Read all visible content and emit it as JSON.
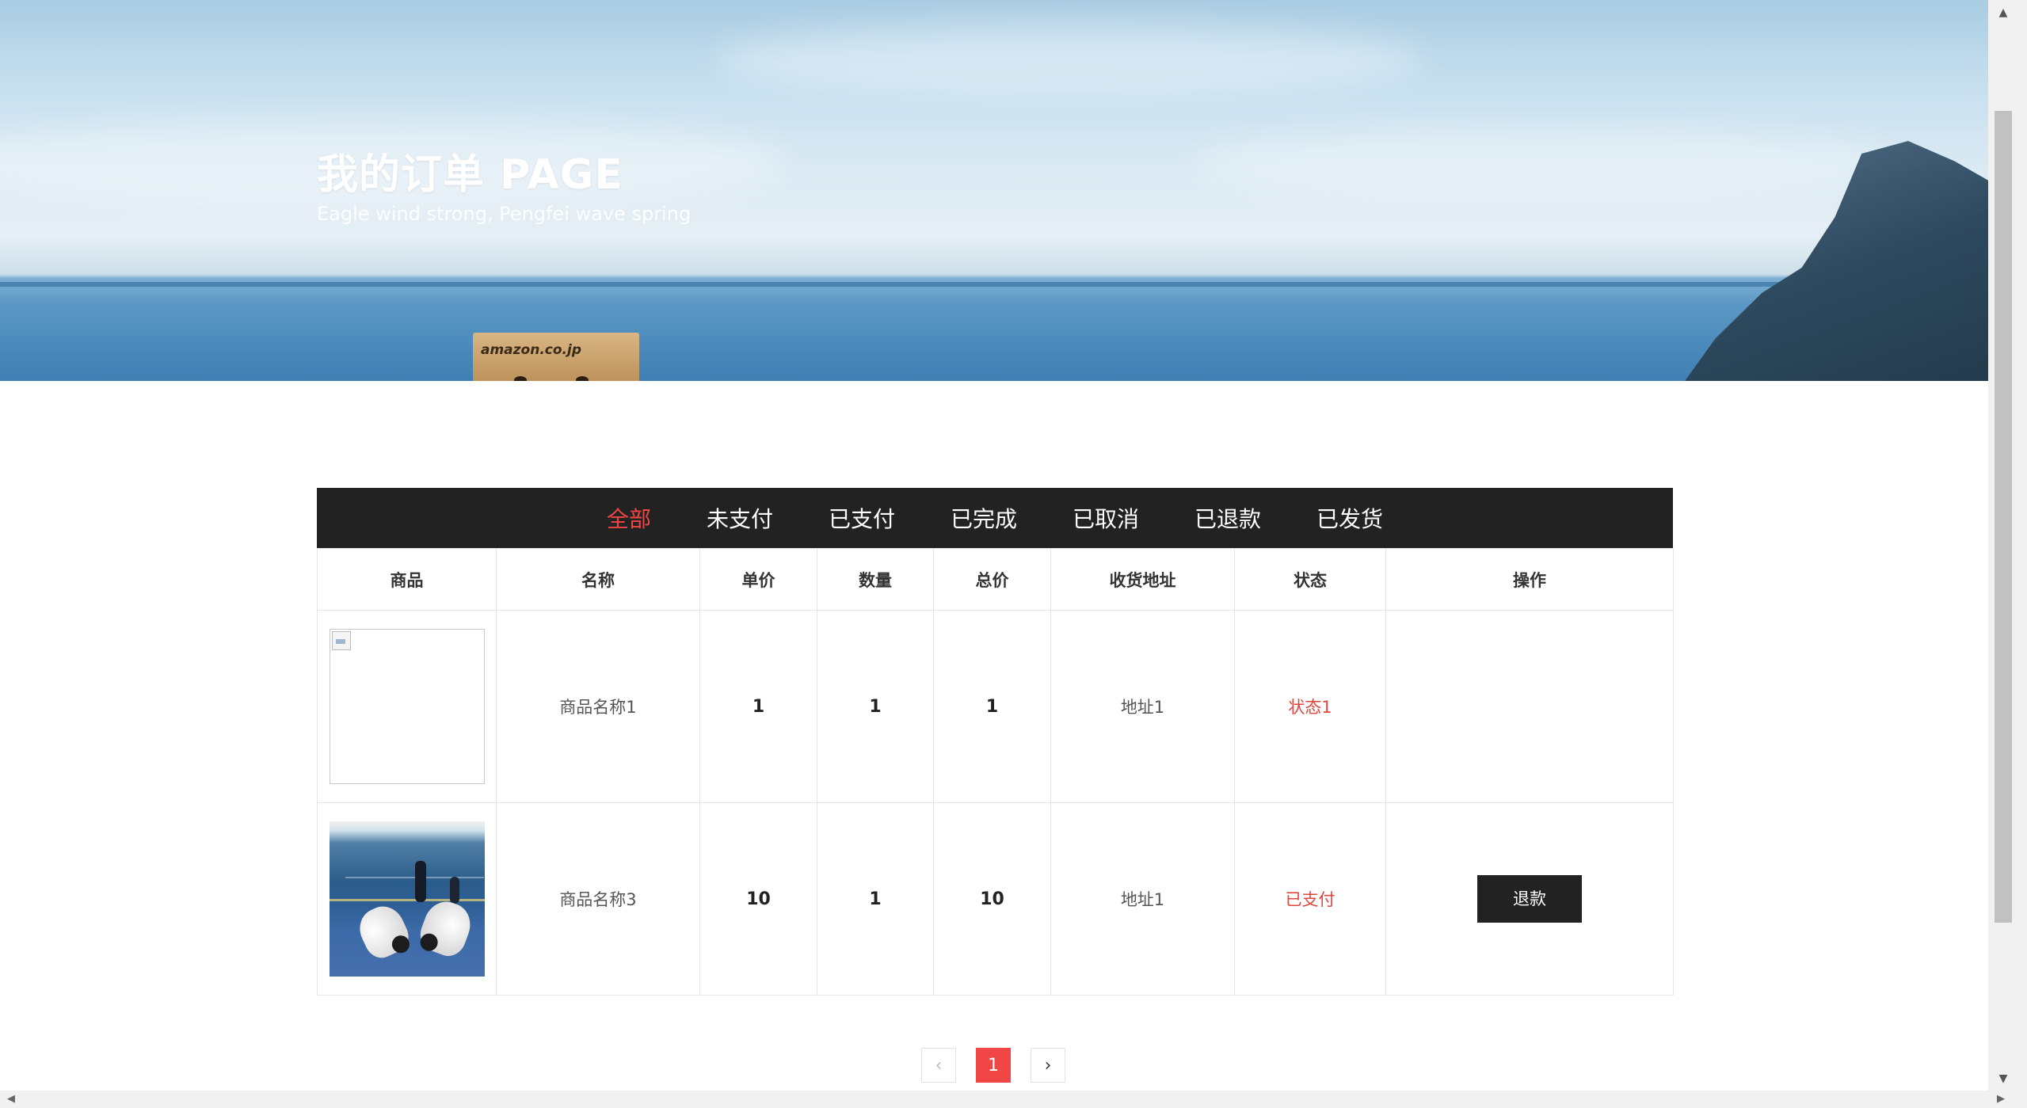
{
  "hero": {
    "title": "我的订单 PAGE",
    "subtitle": "Eagle wind strong, Pengfei wave spring",
    "box_text": "amazon.co.jp"
  },
  "tabs": [
    {
      "label": "全部",
      "active": true
    },
    {
      "label": "未支付",
      "active": false
    },
    {
      "label": "已支付",
      "active": false
    },
    {
      "label": "已完成",
      "active": false
    },
    {
      "label": "已取消",
      "active": false
    },
    {
      "label": "已退款",
      "active": false
    },
    {
      "label": "已发货",
      "active": false
    }
  ],
  "table": {
    "headers": [
      "商品",
      "名称",
      "单价",
      "数量",
      "总价",
      "收货地址",
      "状态",
      "操作"
    ],
    "rows": [
      {
        "image": "broken-image",
        "name": "商品名称1",
        "price": "1",
        "quantity": "1",
        "total": "1",
        "address": "地址1",
        "status": "状态1",
        "action": ""
      },
      {
        "image": "badminton-photo",
        "name": "商品名称3",
        "price": "10",
        "quantity": "1",
        "total": "10",
        "address": "地址1",
        "status": "已支付",
        "action": "退款"
      }
    ]
  },
  "pagination": {
    "prev": "‹",
    "current": "1",
    "next": "›"
  },
  "colors": {
    "accent": "#f04645",
    "tabbar": "#222222",
    "status": "#e0463d"
  }
}
